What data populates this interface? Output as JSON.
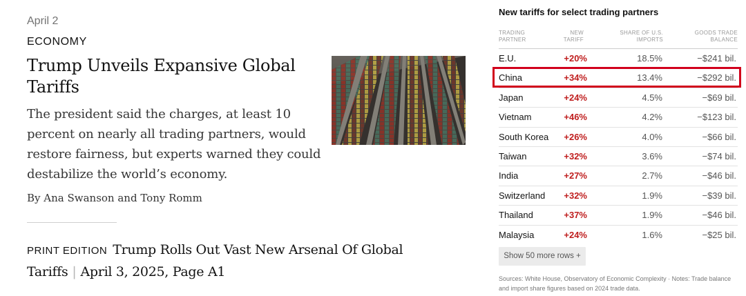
{
  "article": {
    "date": "April 2",
    "section": "ECONOMY",
    "headline": "Trump Unveils Expansive Global Tariffs",
    "summary": "The president said the charges, at least 10 percent on nearly all trading partners, would restore fairness, but experts warned they could destabilize the world’s economy.",
    "byline": "By Ana Swanson and Tony Romm",
    "print_edition": {
      "label": "PRINT EDITION",
      "headline": "Trump Rolls Out Vast New Arsenal Of Global Tariffs",
      "separator": "|",
      "date_page": "April 3, 2025, Page A1"
    }
  },
  "table": {
    "title": "New tariffs for select trading partners",
    "headers": {
      "partner": "Trading partner",
      "tariff": "New tariff",
      "share": "Share of U.S. imports",
      "balance": "Goods trade balance"
    },
    "rows": [
      {
        "partner": "E.U.",
        "tariff": "+20%",
        "share": "18.5%",
        "balance": "−$241 bil."
      },
      {
        "partner": "China",
        "tariff": "+34%",
        "share": "13.4%",
        "balance": "−$292 bil."
      },
      {
        "partner": "Japan",
        "tariff": "+24%",
        "share": "4.5%",
        "balance": "−$69 bil."
      },
      {
        "partner": "Vietnam",
        "tariff": "+46%",
        "share": "4.2%",
        "balance": "−$123 bil."
      },
      {
        "partner": "South Korea",
        "tariff": "+26%",
        "share": "4.0%",
        "balance": "−$66 bil."
      },
      {
        "partner": "Taiwan",
        "tariff": "+32%",
        "share": "3.6%",
        "balance": "−$74 bil."
      },
      {
        "partner": "India",
        "tariff": "+27%",
        "share": "2.7%",
        "balance": "−$46 bil."
      },
      {
        "partner": "Switzerland",
        "tariff": "+32%",
        "share": "1.9%",
        "balance": "−$39 bil."
      },
      {
        "partner": "Thailand",
        "tariff": "+37%",
        "share": "1.9%",
        "balance": "−$46 bil."
      },
      {
        "partner": "Malaysia",
        "tariff": "+24%",
        "share": "1.6%",
        "balance": "−$25 bil."
      }
    ],
    "highlighted_row": 1,
    "show_more_label": "Show 50 more rows +",
    "sources": "Sources: White House, Observatory of Economic Complexity · Notes: Trade balance and import share figures based on 2024 trade data."
  },
  "colors": {
    "tariff_text": "#bf1d1d",
    "highlight_border": "#d1001b"
  }
}
